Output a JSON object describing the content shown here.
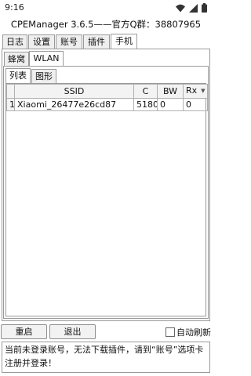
{
  "status": {
    "time": "9:16"
  },
  "window": {
    "title": "CPEManager 3.6.5——官方Q群：38807965"
  },
  "main_tabs": [
    "日志",
    "设置",
    "账号",
    "插件",
    "手机"
  ],
  "sub_tabs": [
    "蜂窝",
    "WLAN"
  ],
  "view_tabs": [
    "列表",
    "图形"
  ],
  "table": {
    "columns": [
      "",
      "SSID",
      "C",
      "BW",
      "Rx"
    ],
    "rows": [
      {
        "idx": "1",
        "ssid": "Xiaomi_26477e26cd87",
        "c": "5180",
        "bw": "0",
        "rx": "0"
      }
    ]
  },
  "buttons": {
    "restart": "重启",
    "exit": "退出"
  },
  "auto_refresh": {
    "label": "自动刷新",
    "checked": false
  },
  "message": "当前未登录账号，无法下载插件，请到“账号”选项卡注册并登录！"
}
